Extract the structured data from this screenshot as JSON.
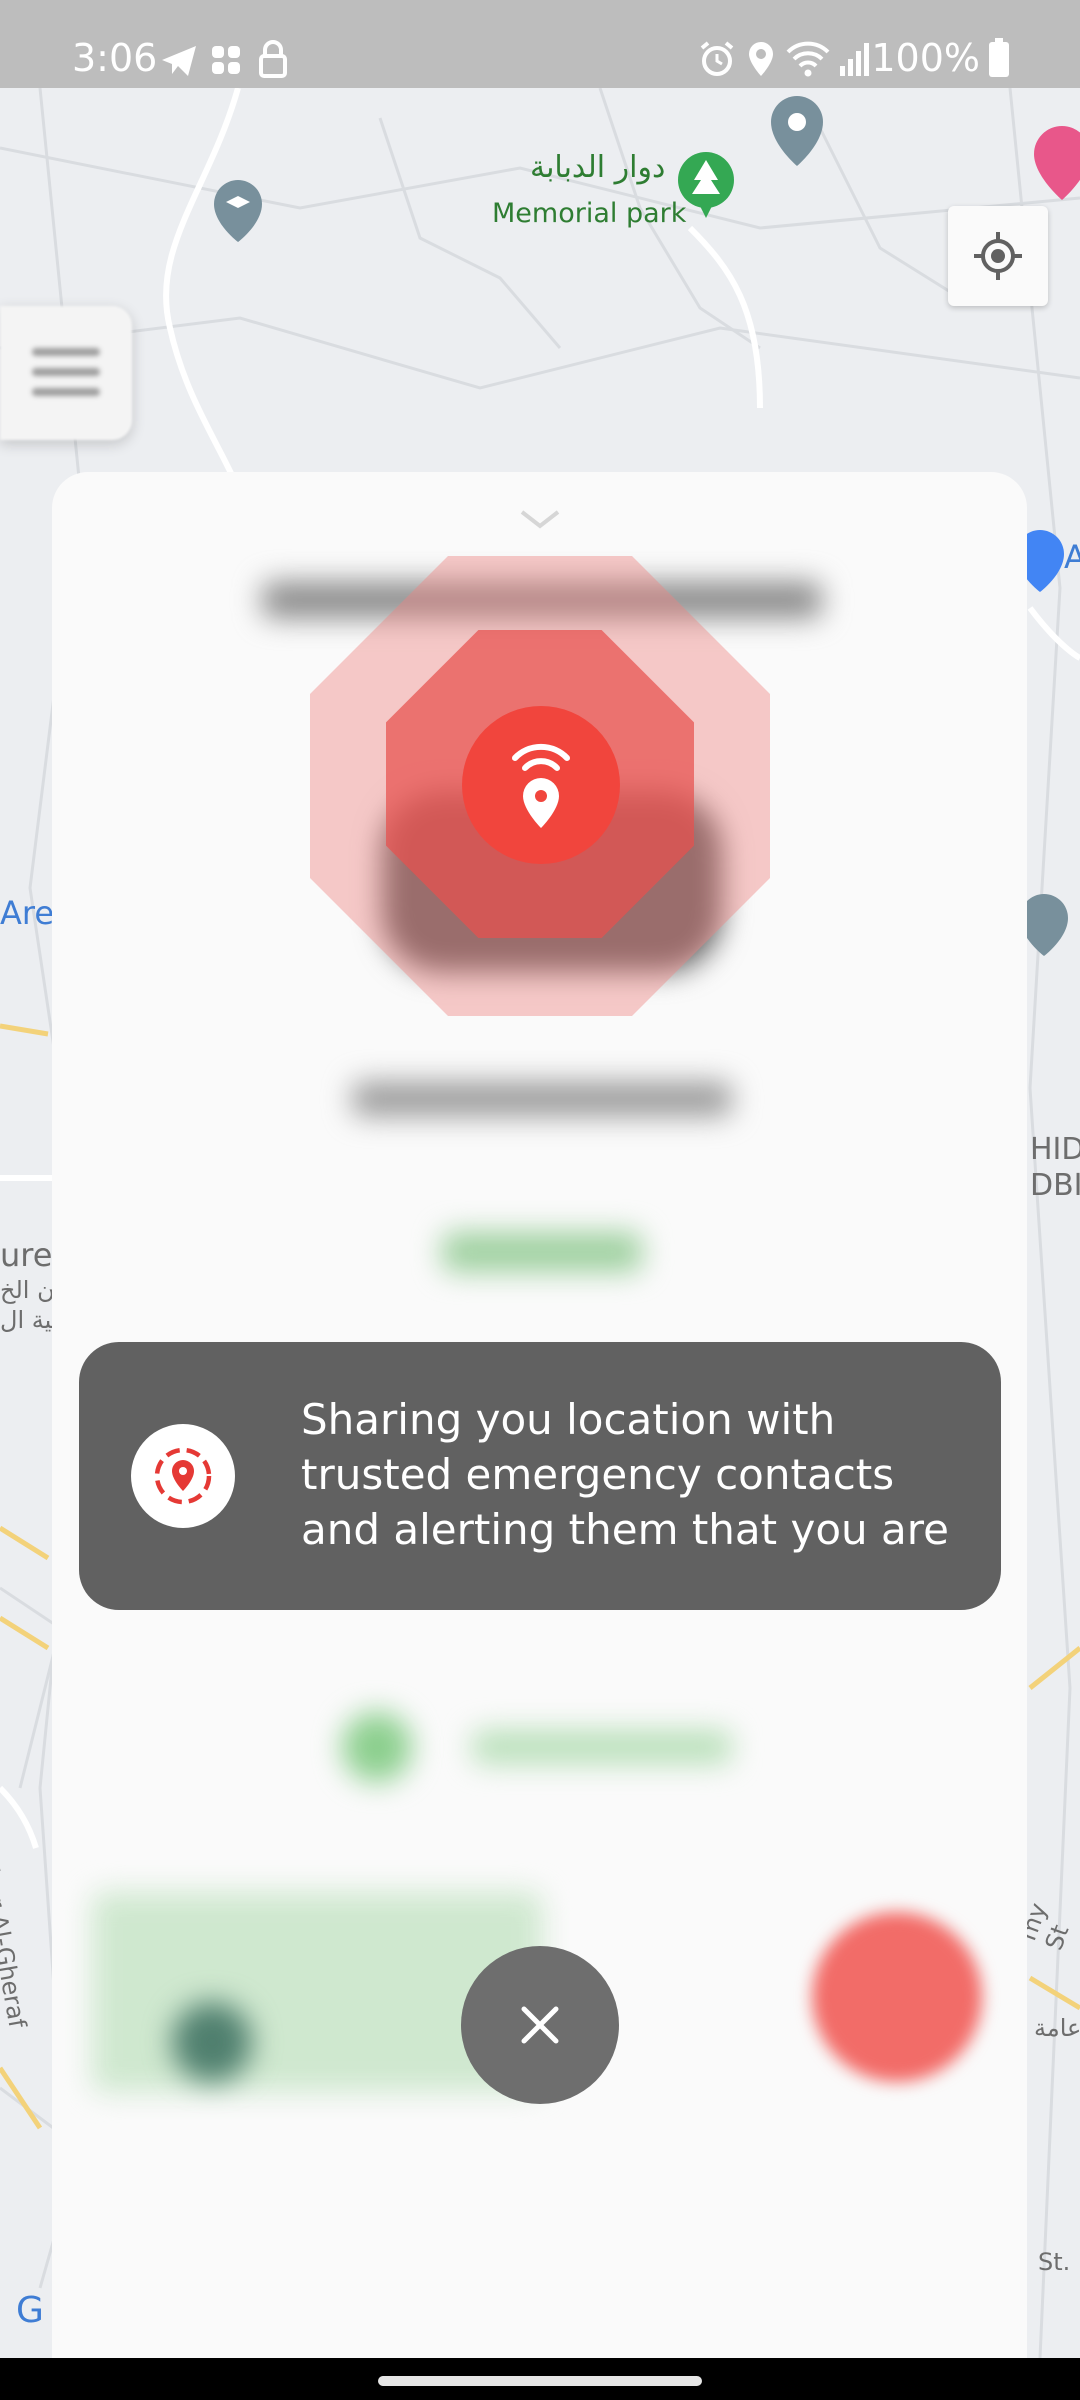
{
  "status_bar": {
    "time": "3:06",
    "battery": "100%",
    "icons": [
      "telegram-icon",
      "app-icon",
      "lock-icon",
      "alarm-icon",
      "location-icon",
      "wifi-icon",
      "signal-icon",
      "battery-icon"
    ]
  },
  "map": {
    "place_labels": {
      "memorial_park_ar": "دوار الدبابة",
      "memorial_park_en": "Memorial park",
      "aree": "Aree",
      "ure": "urea",
      "ar_left_1": "ان الخ",
      "ar_left_2": "نية ال",
      "hid": "HID",
      "dbi": "DBI",
      "abu_dhar": "Abu Dhar Al-Gheraf",
      "my_st": "my St",
      "ar_right": "عامة",
      "g": "G",
      "a_right": "A",
      "st": "St."
    }
  },
  "sheet": {
    "radar_icon": "location-broadcast-icon",
    "toast": {
      "icon": "location-sharing-icon",
      "message": "Sharing you location with trusted emergency contacts and alerting them that you are"
    },
    "close_icon": "close-icon"
  },
  "colors": {
    "accent_red": "#f1453d",
    "toast_bg": "#616161",
    "close_bg": "#6e6e6e",
    "status_bar": "#bdbdbd"
  }
}
